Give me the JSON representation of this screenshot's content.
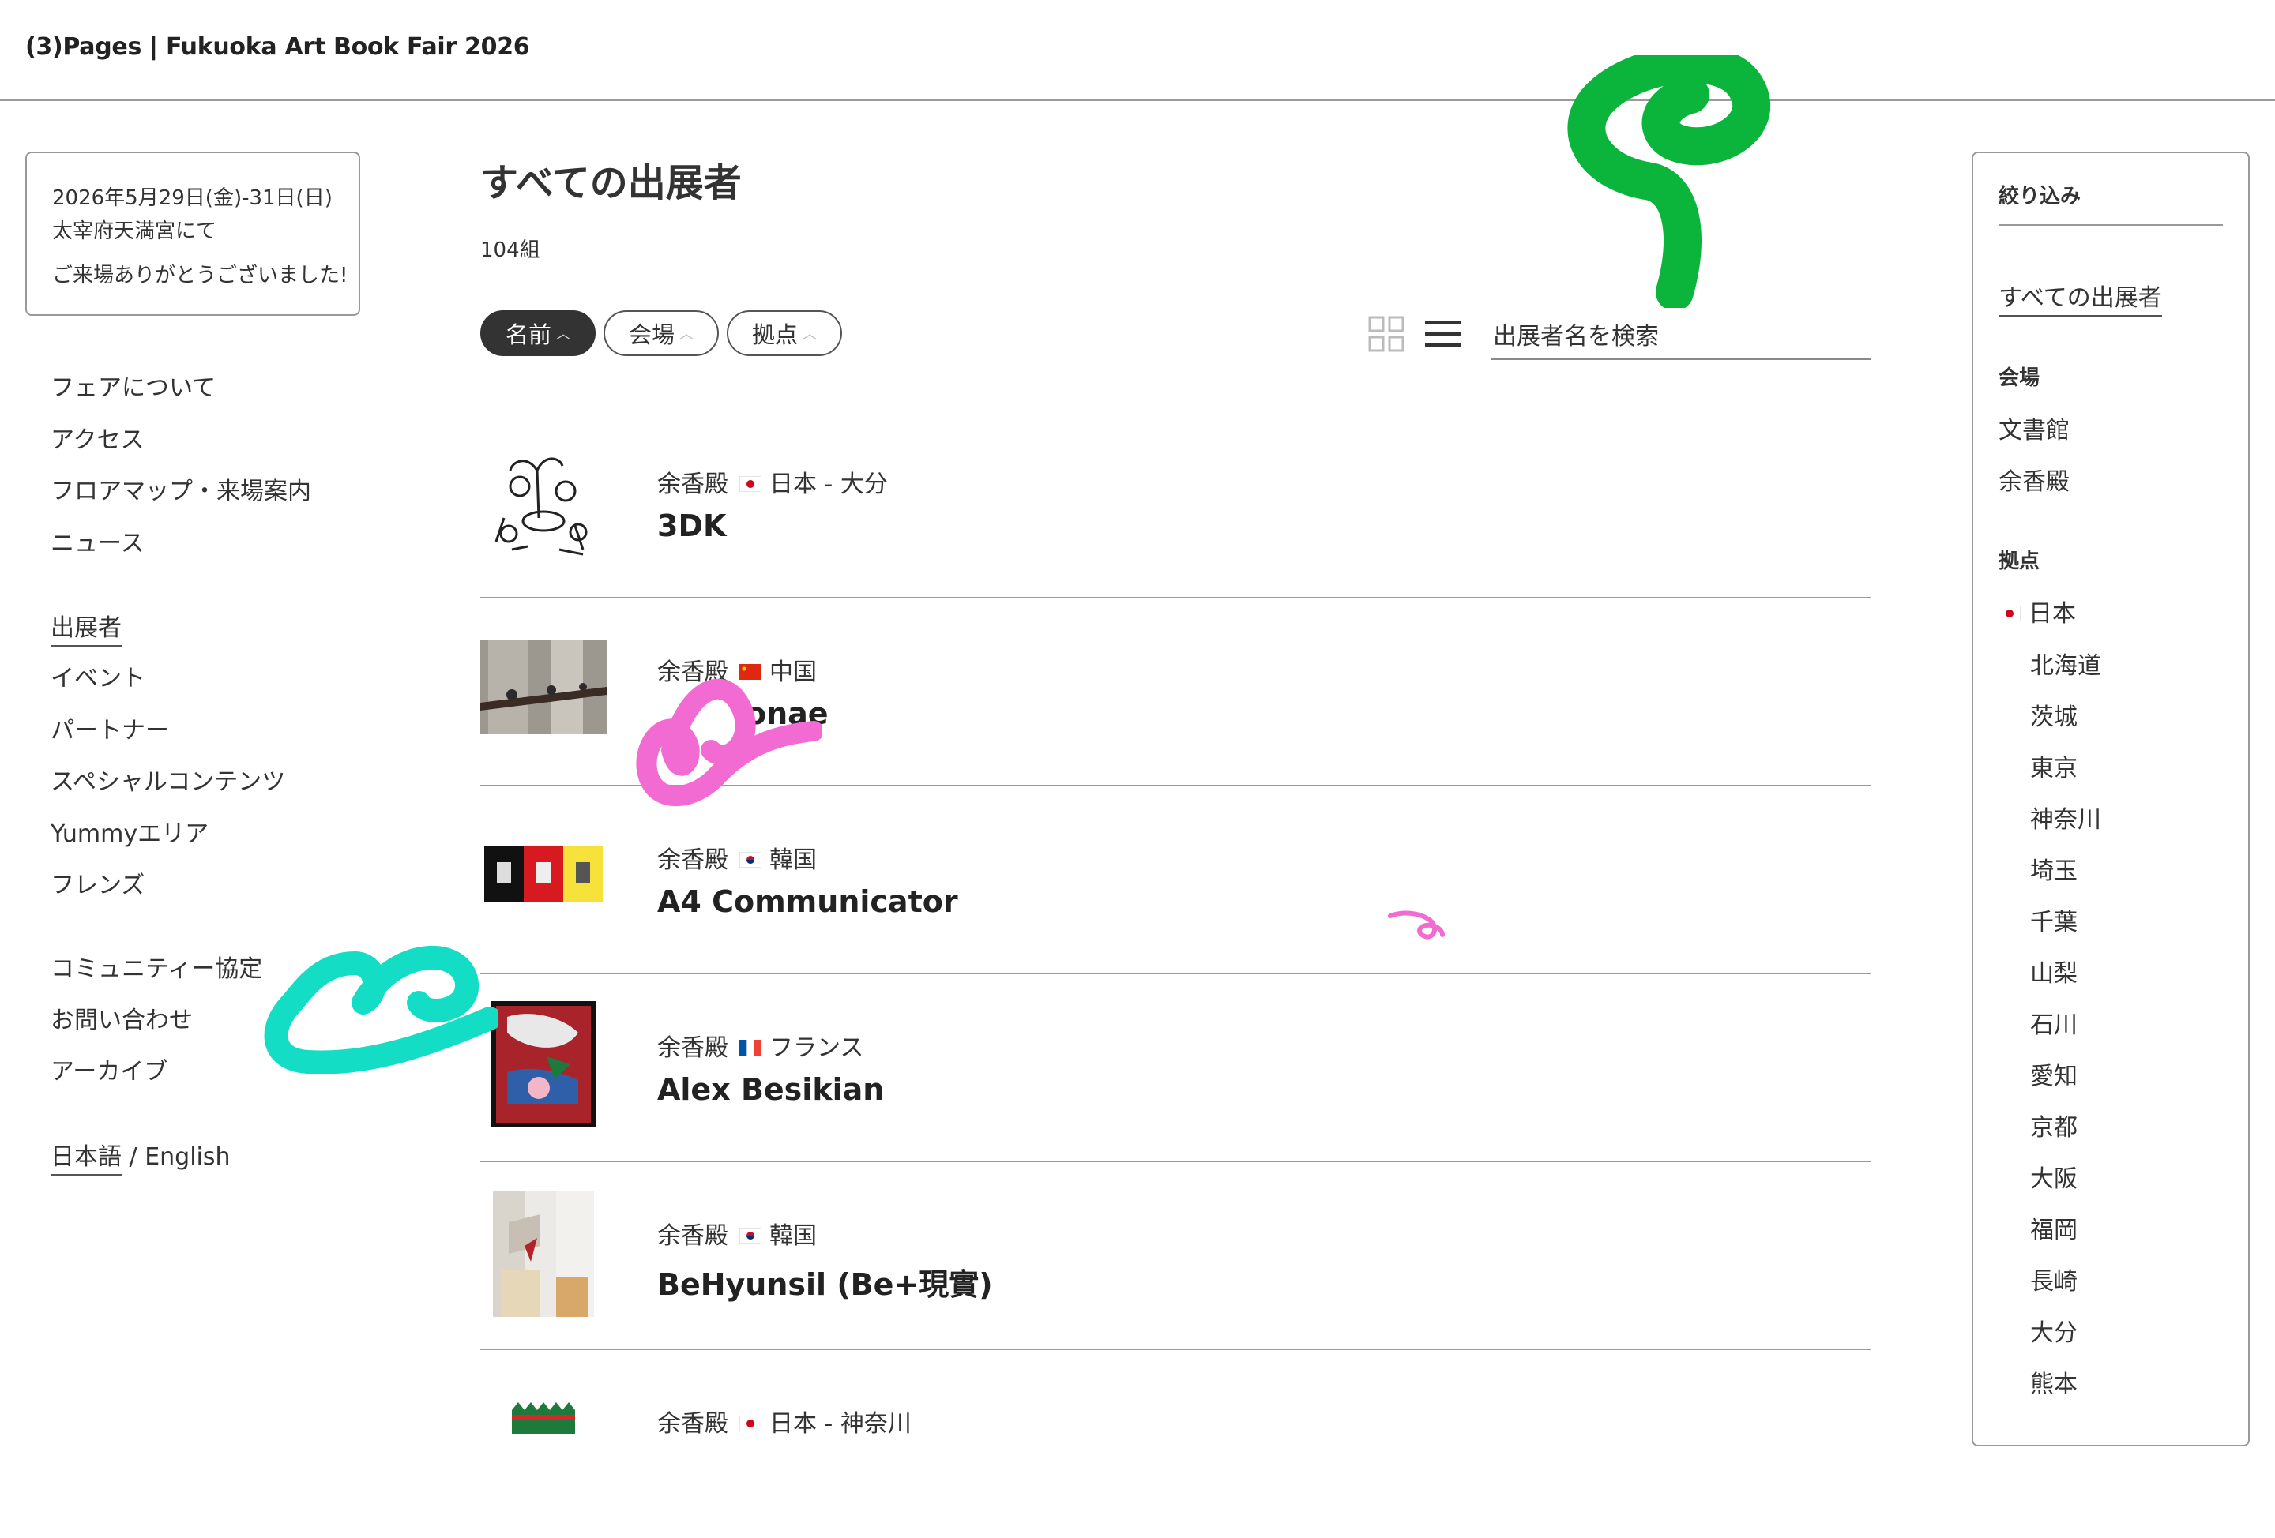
{
  "header": {
    "title": "(3)Pages | Fukuoka Art Book Fair 2026"
  },
  "info": {
    "date": "2026年5月29日(金)-31日(日)",
    "venue": "太宰府天満宮にて",
    "thanks": "ご来場ありがとうございました!"
  },
  "nav": {
    "group1": [
      "フェアについて",
      "アクセス",
      "フロアマップ・来場案内",
      "ニュース"
    ],
    "group2": [
      "出展者",
      "イベント",
      "パートナー",
      "スペシャルコンテンツ",
      "Yummyエリア",
      "フレンズ"
    ],
    "group3": [
      "コミュニティー協定",
      "お問い合わせ",
      "アーカイブ"
    ],
    "lang_ja": "日本語",
    "lang_sep": " / ",
    "lang_en": "English"
  },
  "main": {
    "title": "すべての出展者",
    "count": "104組",
    "sort": {
      "name": "名前",
      "venue": "会場",
      "base": "拠点"
    },
    "search_placeholder": "出展者名を検索",
    "exhibitors": [
      {
        "venue": "余香殿",
        "flag": "japan-flag",
        "country": "日本 - 大分",
        "name": "3DK"
      },
      {
        "venue": "余香殿",
        "flag": "china-flag",
        "country": "中国",
        "name": "onae"
      },
      {
        "venue": "余香殿",
        "flag": "korea-flag",
        "country": "韓国",
        "name": "A4 Communicator"
      },
      {
        "venue": "余香殿",
        "flag": "france-flag",
        "country": "フランス",
        "name": "Alex Besikian"
      },
      {
        "venue": "余香殿",
        "flag": "korea-flag",
        "country": "韓国",
        "name": "BeHyunsil (Be+現實)"
      },
      {
        "venue": "余香殿",
        "flag": "japan-flag",
        "country": "日本 - 神奈川",
        "name": ""
      }
    ]
  },
  "filter": {
    "title": "絞り込み",
    "all": "すべての出展者",
    "venue_head": "会場",
    "venues": [
      "文書館",
      "余香殿"
    ],
    "base_head": "拠点",
    "country": "日本",
    "prefectures": [
      "北海道",
      "茨城",
      "東京",
      "神奈川",
      "埼玉",
      "千葉",
      "山梨",
      "石川",
      "愛知",
      "京都",
      "大阪",
      "福岡",
      "長崎",
      "大分",
      "熊本"
    ]
  },
  "colors": {
    "doodle_green": "#0bb43a",
    "doodle_pink": "#f26bd3",
    "doodle_teal": "#14ddc6",
    "text": "#333333"
  }
}
